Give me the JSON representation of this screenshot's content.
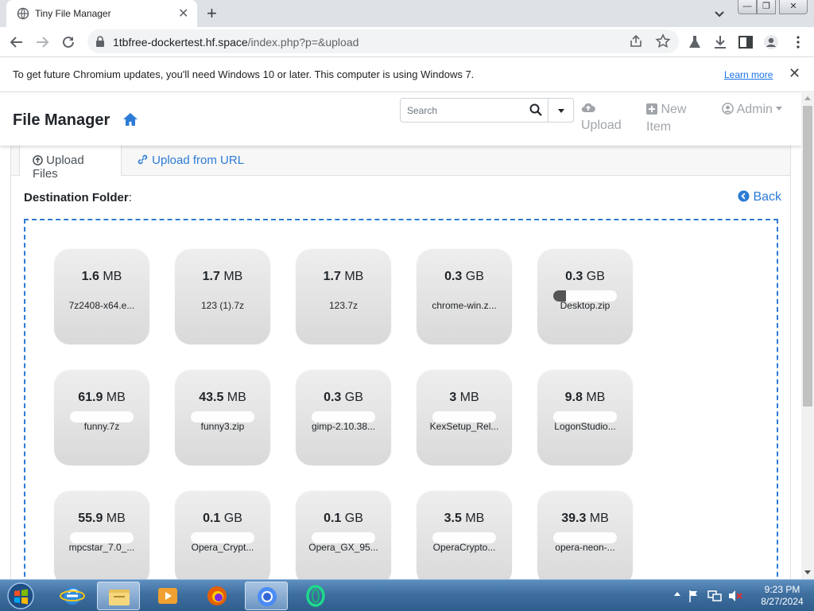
{
  "browser": {
    "tab_title": "Tiny File Manager",
    "url_host": "1tbfree-dockertest.hf.space",
    "url_path": "/index.php?p=&upload",
    "infobar_message": "To get future Chromium updates, you'll need Windows 10 or later. This computer is using Windows 7.",
    "infobar_link": "Learn more"
  },
  "app": {
    "brand": "File Manager",
    "search_placeholder": "Search",
    "nav": {
      "upload": "Upload",
      "new": "New",
      "item": "Item",
      "admin": "Admin"
    },
    "tabs": {
      "upload_files": "Upload Files",
      "upload_url": "Upload from URL"
    },
    "destination_label": "Destination Folder",
    "back": "Back"
  },
  "files": [
    {
      "size_num": "1.6",
      "size_unit": "MB",
      "name": "7z2408-x64.e..."
    },
    {
      "size_num": "1.7",
      "size_unit": "MB",
      "name": "123 (1).7z"
    },
    {
      "size_num": "1.7",
      "size_unit": "MB",
      "name": "123.7z"
    },
    {
      "size_num": "0.3",
      "size_unit": "GB",
      "name": "chrome-win.z..."
    },
    {
      "size_num": "0.3",
      "size_unit": "GB",
      "name": "Desktop.zip"
    },
    {
      "size_num": "61.9",
      "size_unit": "MB",
      "name": "funny.7z"
    },
    {
      "size_num": "43.5",
      "size_unit": "MB",
      "name": "funny3.zip"
    },
    {
      "size_num": "0.3",
      "size_unit": "GB",
      "name": "gimp-2.10.38..."
    },
    {
      "size_num": "3",
      "size_unit": "MB",
      "name": "KexSetup_Rel..."
    },
    {
      "size_num": "9.8",
      "size_unit": "MB",
      "name": "LogonStudio..."
    },
    {
      "size_num": "55.9",
      "size_unit": "MB",
      "name": "mpcstar_7.0_..."
    },
    {
      "size_num": "0.1",
      "size_unit": "GB",
      "name": "Opera_Crypt..."
    },
    {
      "size_num": "0.1",
      "size_unit": "GB",
      "name": "Opera_GX_95..."
    },
    {
      "size_num": "3.5",
      "size_unit": "MB",
      "name": "OperaCrypto..."
    },
    {
      "size_num": "39.3",
      "size_unit": "MB",
      "name": "opera-neon-..."
    }
  ],
  "taskbar": {
    "time": "9:23 PM",
    "date": "8/27/2024"
  },
  "colors": {
    "link": "#2d7bd6",
    "dropzone": "#2d7bd6",
    "taskbar": "#3e6f9f"
  }
}
